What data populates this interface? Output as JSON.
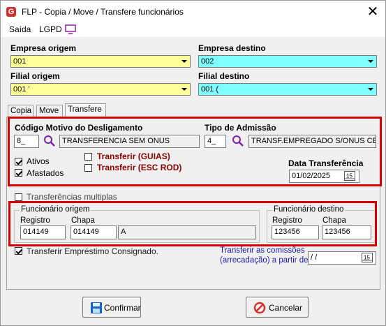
{
  "window": {
    "title": "FLP - Copia / Move / Transfere funcionários",
    "close_glyph": "✕"
  },
  "menu": {
    "exit_label": "Saída",
    "lgpd_label": "LGPD",
    "monitor_icon": "monitor-icon"
  },
  "company": {
    "origin_label": "Empresa origem",
    "origin_value": "001",
    "dest_label": "Empresa destino",
    "dest_value": "002",
    "branch_origin_label": "Filial origem",
    "branch_origin_value": "001 '",
    "branch_dest_label": "Filial destino",
    "branch_dest_value": "001 ("
  },
  "tabs": [
    {
      "label": "Copia"
    },
    {
      "label": "Move"
    },
    {
      "label": "Transfere"
    }
  ],
  "transfer": {
    "reason_label": "Código Motivo do Desligamento",
    "reason_code": "8_",
    "reason_desc": "TRANSFERENCIA SEM ONUS",
    "admission_label": "Tipo de Admissão",
    "admission_code": "4_",
    "admission_desc": "TRANSF.EMPREGADO S/ONUS CE",
    "ativos_label": "Ativos",
    "afastados_label": "Afastados",
    "guias_label": "Transferir (GUIAS)",
    "esc_rod_label": "Transferir (ESC ROD)",
    "date_label": "Data Transferência",
    "date_value": "01/02/2025",
    "multiple_label": "Transferências multiplas",
    "loan_label": "Transferir Empréstimo Consignado.",
    "commission_label_1": "Transferir as comissões",
    "commission_label_2": "(arrecadação)  a partir de :",
    "commission_date": " /  /"
  },
  "employee_origin": {
    "title": "Funcionário origem",
    "registro_label": "Registro",
    "registro_value": "014149",
    "chapa_label": "Chapa",
    "chapa_value": "014149",
    "name_value": "A"
  },
  "employee_dest": {
    "title": "Funcionário destino",
    "registro_label": "Registro",
    "registro_value": "123456",
    "chapa_label": "Chapa",
    "chapa_value": "123456"
  },
  "buttons": {
    "confirm_label": "Confirmar",
    "cancel_label": "Cancelar"
  },
  "colors": {
    "yellow": "#ffff99",
    "cyan": "#7fffff",
    "highlight": "#d50000",
    "accent_dark_red": "#8b0000"
  }
}
